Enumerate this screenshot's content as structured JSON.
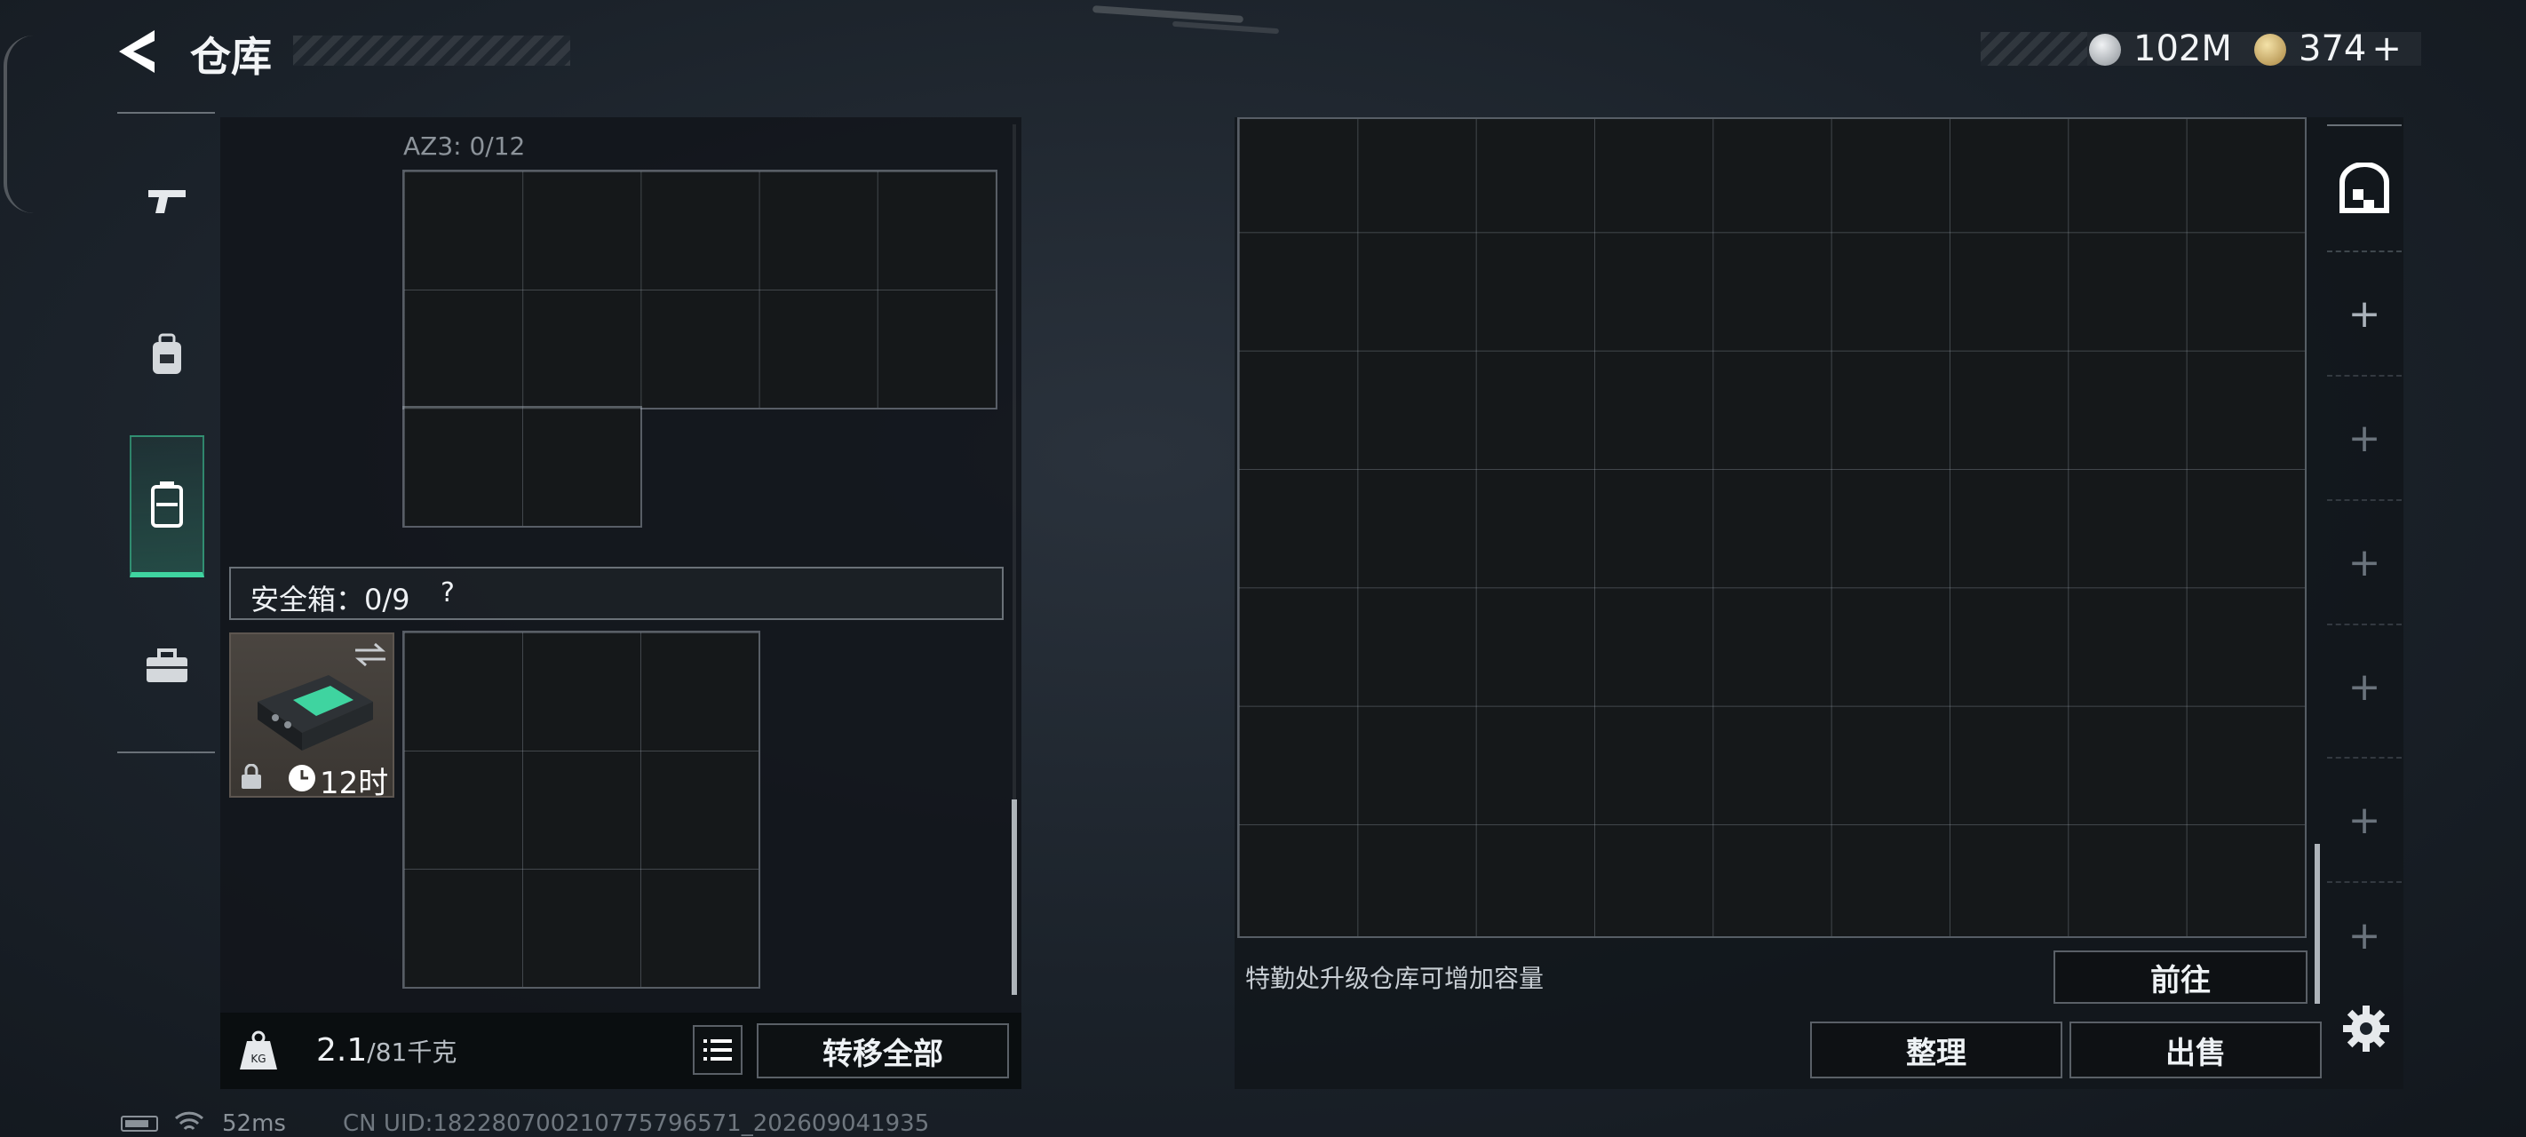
{
  "header": {
    "title": "仓库"
  },
  "currency": [
    {
      "icon": "silver-coin-icon",
      "value": "102M"
    },
    {
      "icon": "gold-coin-icon",
      "value": "374",
      "suffix": "+"
    }
  ],
  "side_tabs": [
    {
      "name": "weapons",
      "icon": "pistol-icon",
      "active": false
    },
    {
      "name": "backpack",
      "icon": "backpack-icon",
      "active": false
    },
    {
      "name": "vest",
      "icon": "vest-icon",
      "active": true
    },
    {
      "name": "tools",
      "icon": "toolbox-icon",
      "active": false
    }
  ],
  "left_panel": {
    "az3_label": "AZ3: 0/12",
    "safebox": {
      "label": "安全箱：0/9",
      "help": "?",
      "timer": "12时"
    },
    "weight": {
      "value": "2.1",
      "max": "/81千克"
    },
    "transfer_all": "转移全部"
  },
  "right_panel": {
    "upgrade_hint": "特勤处升级仓库可增加容量",
    "goto": "前往",
    "organize": "整理",
    "sell": "出售"
  },
  "status_bar": {
    "ping": "52ms",
    "uid": "CN UID:182280700210775796571_202609041935"
  },
  "colors": {
    "accent_green": "#3fd4a0",
    "panel_bg": "#14191e"
  }
}
